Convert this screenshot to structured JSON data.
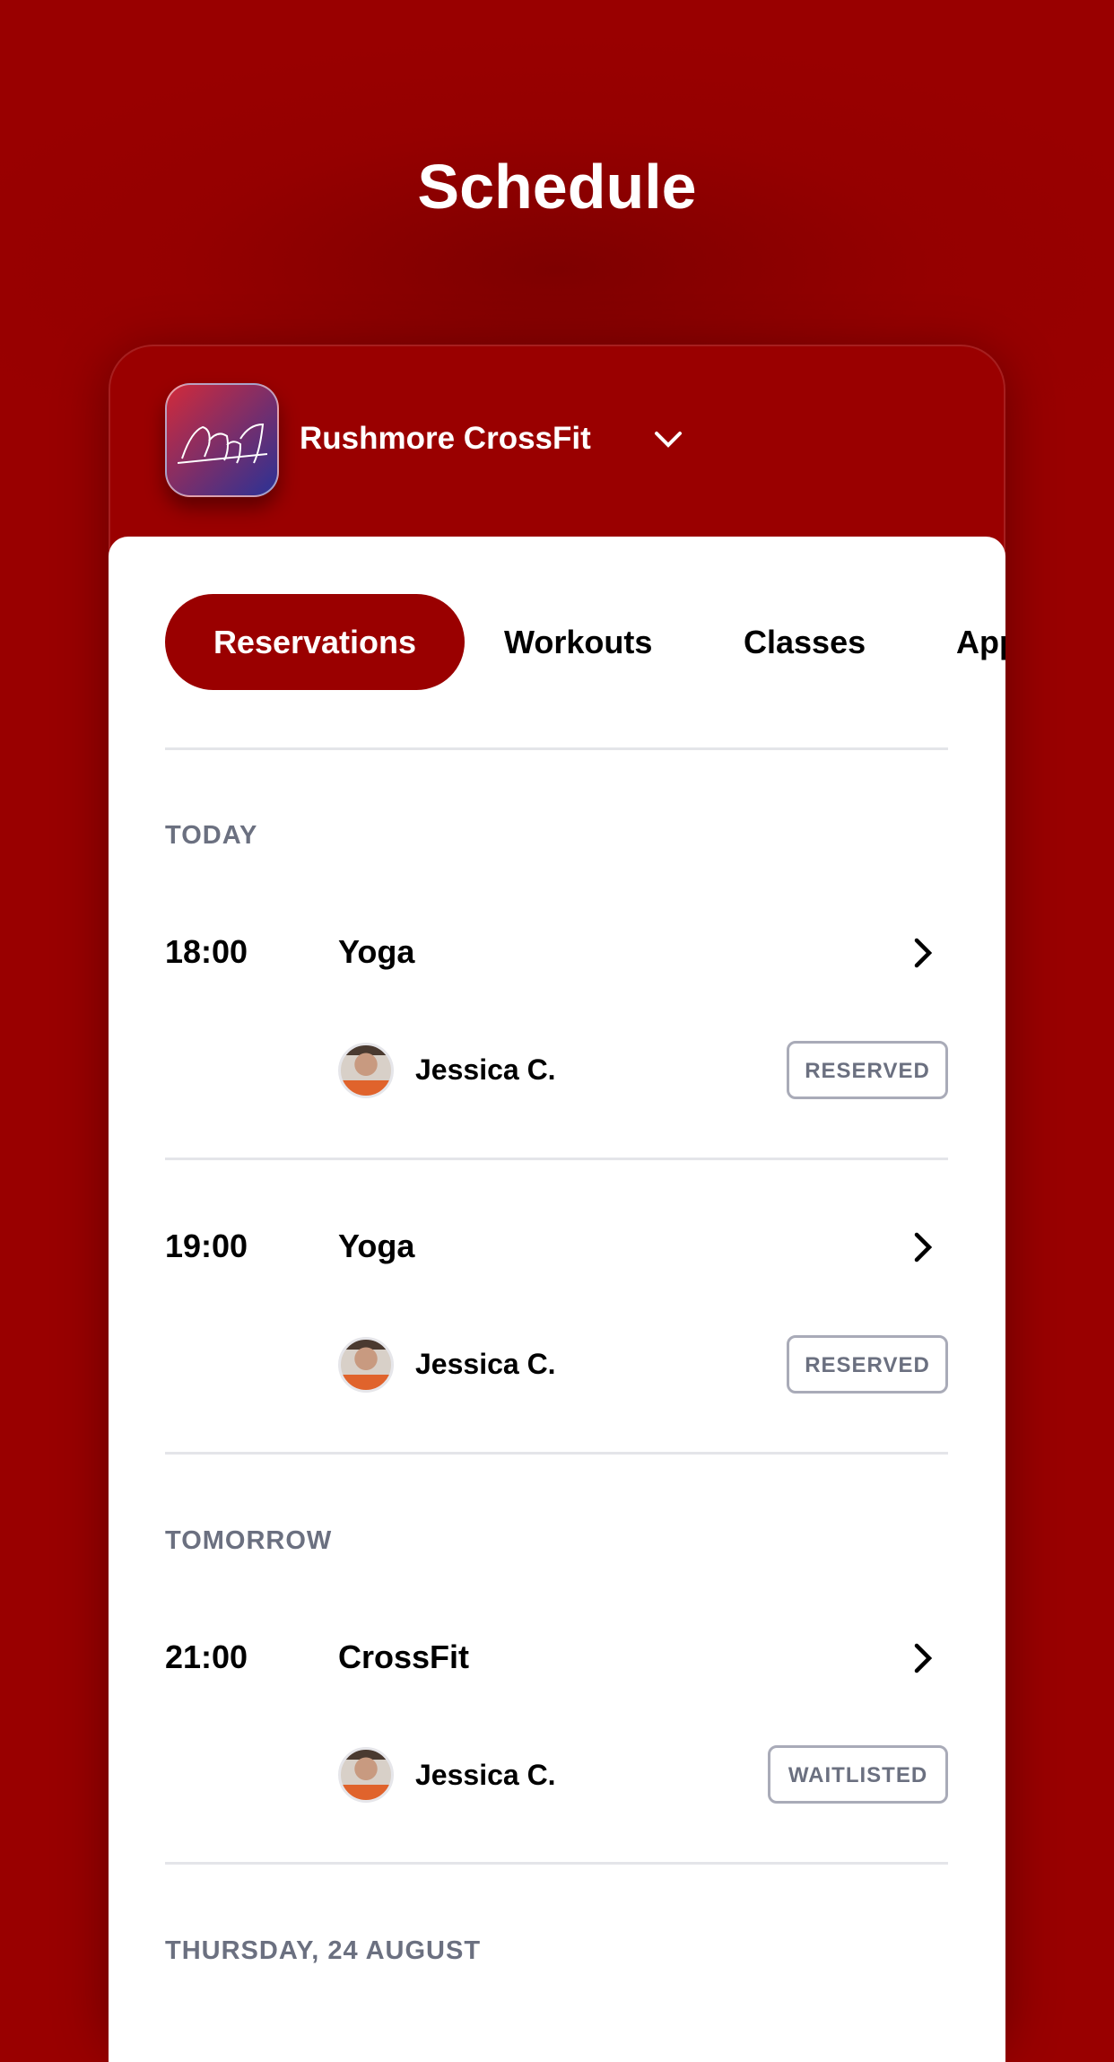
{
  "page_title": "Schedule",
  "gym": {
    "name": "Rushmore CrossFit",
    "logo": "mount-rushmore-logo"
  },
  "tabs": [
    {
      "label": "Reservations",
      "active": true
    },
    {
      "label": "Workouts"
    },
    {
      "label": "Classes"
    },
    {
      "label": "App"
    }
  ],
  "sections": [
    {
      "label": "TODAY",
      "items": [
        {
          "time": "18:00",
          "class": "Yoga",
          "coach": "Jessica C.",
          "status": "RESERVED"
        },
        {
          "time": "19:00",
          "class": "Yoga",
          "coach": "Jessica C.",
          "status": "RESERVED"
        }
      ]
    },
    {
      "label": "TOMORROW",
      "items": [
        {
          "time": "21:00",
          "class": "CrossFit",
          "coach": "Jessica C.",
          "status": "WAITLISTED"
        }
      ]
    },
    {
      "label": "THURSDAY, 24 AUGUST",
      "items": []
    }
  ],
  "colors": {
    "brand": "#9a0000",
    "muted": "#6b7080",
    "badge_border": "#a9abb8"
  }
}
